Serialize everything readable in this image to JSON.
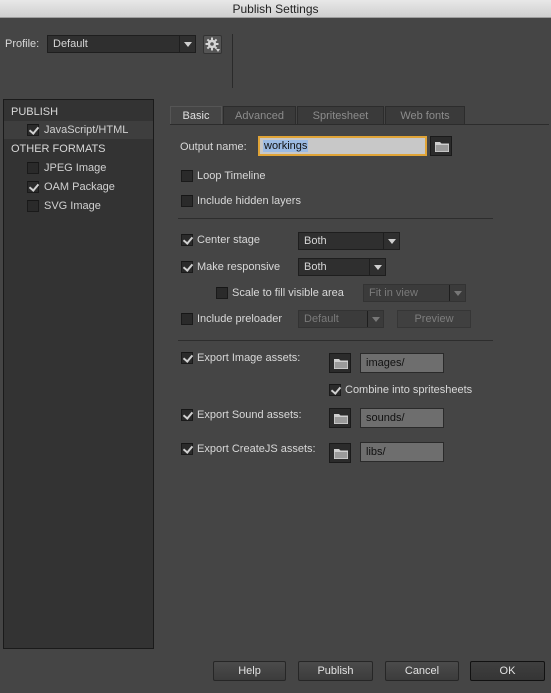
{
  "window": {
    "title": "Publish Settings"
  },
  "profile": {
    "label": "Profile:",
    "value": "Default"
  },
  "sidebar": {
    "publish_header": "PUBLISH",
    "publish_items": [
      {
        "label": "JavaScript/HTML",
        "checked": true
      }
    ],
    "other_header": "OTHER FORMATS",
    "other_items": [
      {
        "label": "JPEG Image",
        "checked": false
      },
      {
        "label": "OAM Package",
        "checked": true
      },
      {
        "label": "SVG Image",
        "checked": false
      }
    ]
  },
  "tabs": [
    "Basic",
    "Advanced",
    "Spritesheet",
    "Web fonts"
  ],
  "basic": {
    "output_label": "Output name:",
    "output_value": "workings",
    "loop_timeline": "Loop Timeline",
    "include_hidden": "Include hidden layers",
    "center_stage": "Center stage",
    "center_stage_value": "Both",
    "make_responsive": "Make responsive",
    "make_responsive_value": "Both",
    "scale_fill": "Scale to fill visible area",
    "scale_fill_value": "Fit in view",
    "include_preloader": "Include preloader",
    "preloader_value": "Default",
    "preview": "Preview",
    "export_image": "Export Image assets:",
    "image_path": "images/",
    "combine_sprites": "Combine into spritesheets",
    "export_sound": "Export Sound assets:",
    "sound_path": "sounds/",
    "export_createjs": "Export CreateJS assets:",
    "createjs_path": "libs/"
  },
  "buttons": {
    "help": "Help",
    "publish": "Publish",
    "cancel": "Cancel",
    "ok": "OK"
  },
  "colors": {
    "background": "#454545",
    "panel": "#333333",
    "focus_ring": "#e0a437"
  }
}
